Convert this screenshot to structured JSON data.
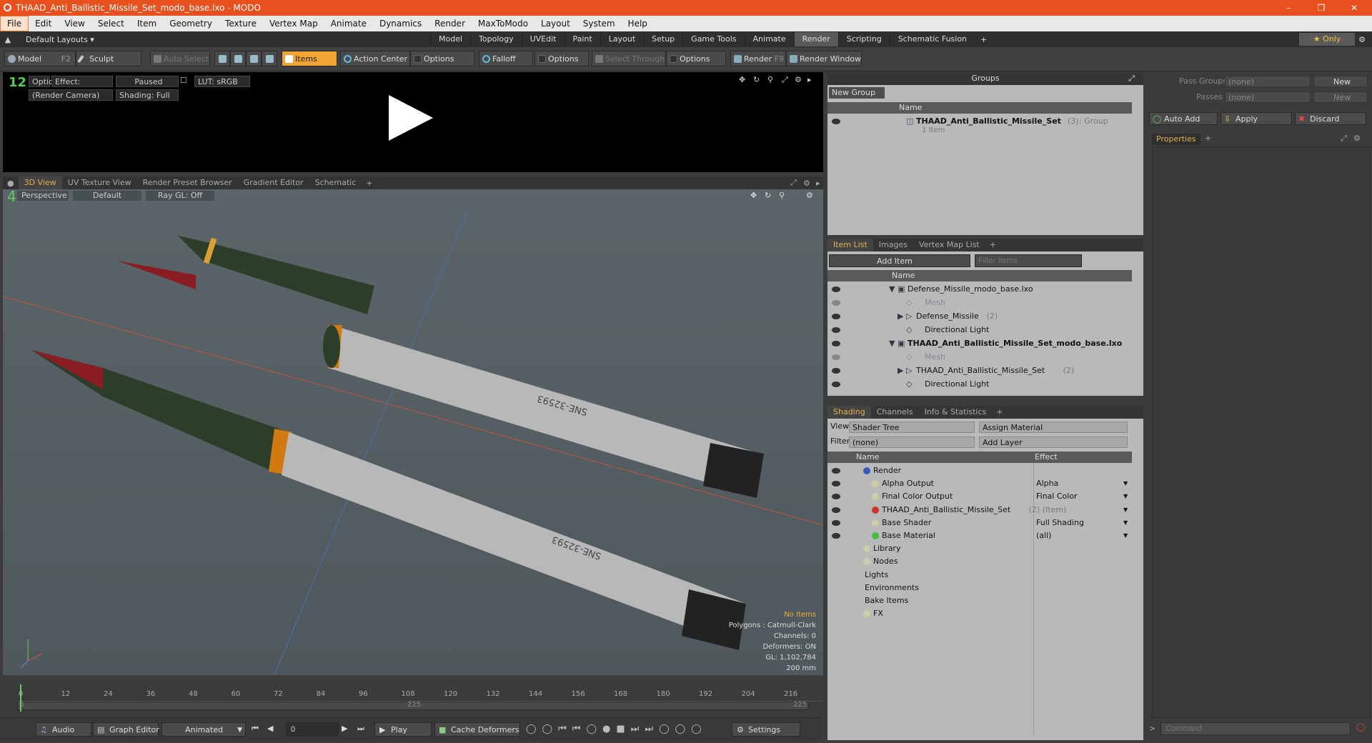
{
  "window": {
    "title": "THAAD_Anti_Ballistic_Missile_Set_modo_base.lxo - MODO"
  },
  "menu": [
    "File",
    "Edit",
    "View",
    "Select",
    "Item",
    "Geometry",
    "Texture",
    "Vertex Map",
    "Animate",
    "Dynamics",
    "Render",
    "MaxToModo",
    "Layout",
    "System",
    "Help"
  ],
  "layout": {
    "label": "Default Layouts ▾",
    "tabs": [
      "Model",
      "Topology",
      "UVEdit",
      "Paint",
      "Layout",
      "Setup",
      "Game Tools",
      "Animate",
      "Render",
      "Scripting",
      "Schematic Fusion"
    ],
    "active": "Render",
    "only": "★ Only"
  },
  "toolbar": {
    "model": "Model",
    "model_key": "F2",
    "sculpt": "Sculpt",
    "auto_select": "Auto Select",
    "items": "Items",
    "action_center": "Action Center",
    "options1": "Options",
    "falloff": "Falloff",
    "options2": "Options",
    "select_through": "Select Through",
    "options3": "Options",
    "render": "Render",
    "render_key": "F9",
    "render_window": "Render Window"
  },
  "render_view": {
    "options": "Options",
    "effect": "Effect: (Shadi...",
    "paused": "Paused",
    "lut": "LUT: sRGB",
    "camera": "(Render Camera)",
    "shading": "Shading: Full"
  },
  "viewport_tabs": [
    "3D View",
    "UV Texture View",
    "Render Preset Browser",
    "Gradient Editor",
    "Schematic"
  ],
  "viewport": {
    "perspective": "Perspective",
    "default": "Default",
    "raygl": "Ray GL: Off",
    "stats": {
      "no_items": "No Items",
      "polygons": "Polygons : Catmull-Clark",
      "channels": "Channels: 0",
      "deformers": "Deformers: ON",
      "gl": "GL: 1,102,784",
      "size": "200 mm"
    },
    "decal_a": "SNE-32593",
    "decal_b": "SNE-32593"
  },
  "timeline": {
    "ticks": [
      "0",
      "12",
      "24",
      "36",
      "48",
      "60",
      "72",
      "84",
      "96",
      "108",
      "120",
      "132",
      "144",
      "156",
      "168",
      "180",
      "192",
      "204",
      "216"
    ],
    "sub_ticks": [
      "0",
      "225",
      "225"
    ]
  },
  "bottom": {
    "audio": "Audio",
    "graph_editor": "Graph Editor",
    "animated": "Animated",
    "frame": "0",
    "play": "Play",
    "cache": "Cache Deformers",
    "settings": "Settings"
  },
  "groups": {
    "title": "Groups",
    "new_group": "New Group",
    "col_name": "Name",
    "item": "THAAD_Anti_Ballistic_Missile_Set",
    "item_count": "(3)",
    "item_type": ": Group",
    "item_sub": "1 Item"
  },
  "item_list": {
    "tabs": [
      "Item List",
      "Images",
      "Vertex Map List"
    ],
    "add_item": "Add Item",
    "filter": "Filter Items",
    "col_name": "Name",
    "rows": [
      {
        "label": "Defense_Missile_modo_base.lxo",
        "extra": "",
        "indent": 0,
        "bold": false,
        "dim": false
      },
      {
        "label": "Mesh",
        "extra": "",
        "indent": 2,
        "bold": false,
        "dim": true
      },
      {
        "label": "Defense_Missile",
        "extra": "(2)",
        "indent": 1,
        "bold": false,
        "dim": false
      },
      {
        "label": "Directional Light",
        "extra": "",
        "indent": 2,
        "bold": false,
        "dim": false
      },
      {
        "label": "THAAD_Anti_Ballistic_Missile_Set_modo_base.lxo",
        "extra": "",
        "indent": 0,
        "bold": true,
        "dim": false
      },
      {
        "label": "Mesh",
        "extra": "",
        "indent": 2,
        "bold": false,
        "dim": true
      },
      {
        "label": "THAAD_Anti_Ballistic_Missile_Set",
        "extra": "(2)",
        "indent": 1,
        "bold": false,
        "dim": false
      },
      {
        "label": "Directional Light",
        "extra": "",
        "indent": 2,
        "bold": false,
        "dim": false
      }
    ]
  },
  "shading": {
    "tabs": [
      "Shading",
      "Channels",
      "Info & Statistics"
    ],
    "view_label": "View",
    "view_value": "Shader Tree",
    "assign": "Assign Material",
    "filter_label": "Filter",
    "filter_value": "(none)",
    "add_layer": "Add Layer",
    "col_name": "Name",
    "col_effect": "Effect",
    "rows": [
      {
        "label": "Render",
        "extra": "",
        "effect": "",
        "indent": 0
      },
      {
        "label": "Alpha Output",
        "extra": "",
        "effect": "Alpha",
        "indent": 1
      },
      {
        "label": "Final Color Output",
        "extra": "",
        "effect": "Final Color",
        "indent": 1
      },
      {
        "label": "THAAD_Anti_Ballistic_Missile_Set",
        "extra": "(2) (Item)",
        "effect": "",
        "indent": 1
      },
      {
        "label": "Base Shader",
        "extra": "",
        "effect": "Full Shading",
        "indent": 1
      },
      {
        "label": "Base Material",
        "extra": "",
        "effect": "(all)",
        "indent": 1
      },
      {
        "label": "Library",
        "extra": "",
        "effect": "",
        "indent": 0
      },
      {
        "label": "Nodes",
        "extra": "",
        "effect": "",
        "indent": 0
      },
      {
        "label": "Lights",
        "extra": "",
        "effect": "",
        "indent": -1
      },
      {
        "label": "Environments",
        "extra": "",
        "effect": "",
        "indent": -1
      },
      {
        "label": "Bake Items",
        "extra": "",
        "effect": "",
        "indent": -1
      },
      {
        "label": "FX",
        "extra": "",
        "effect": "",
        "indent": 0
      }
    ]
  },
  "passes": {
    "pass_groups": "Pass Groups",
    "passes": "Passes",
    "none": "(none)",
    "new": "New",
    "auto_add": "Auto Add",
    "apply": "Apply",
    "discard": "Discard",
    "properties": "Properties"
  },
  "command": {
    "placeholder": "Command"
  }
}
